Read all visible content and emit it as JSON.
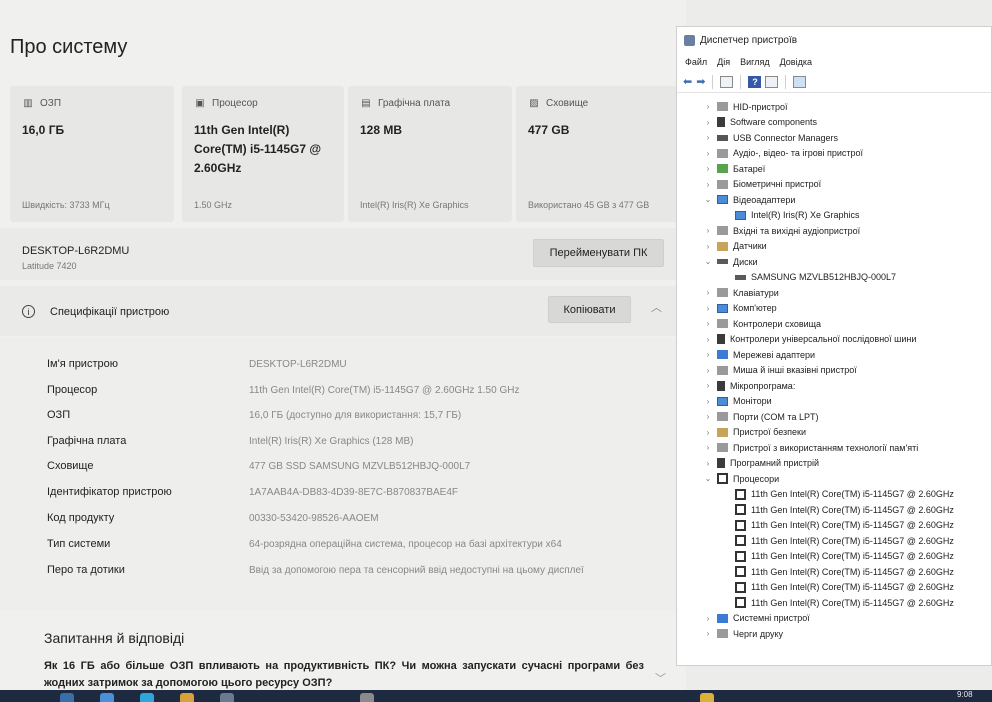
{
  "about": {
    "title": "Про систему",
    "cards": [
      {
        "icon": "ram-icon",
        "label": "ОЗП",
        "value": "16,0 ГБ",
        "sub": "Швидкість: 3733 МГц"
      },
      {
        "icon": "processor-icon",
        "label": "Процесор",
        "value": "11th Gen Intel(R) Core(TM) i5-1145G7 @ 2.60GHz",
        "sub": "1.50 GHz"
      },
      {
        "icon": "graphics-card-icon",
        "label": "Графічна плата",
        "value": "128 MB",
        "sub": "Intel(R) Iris(R) Xe Graphics"
      },
      {
        "icon": "storage-icon",
        "label": "Сховище",
        "value": "477 GB",
        "sub": "Використано 45 GB з 477 GB"
      }
    ],
    "device": {
      "name": "DESKTOP-L6R2DMU",
      "model": "Latitude 7420",
      "rename_label": "Перейменувати ПК"
    },
    "specs_section": {
      "title": "Специфікації пристрою",
      "copy_label": "Копіювати"
    },
    "specs": [
      {
        "label": "Ім'я пристрою",
        "value": "DESKTOP-L6R2DMU"
      },
      {
        "label": "Процесор",
        "value": "11th Gen Intel(R) Core(TM) i5-1145G7 @ 2.60GHz   1.50 GHz"
      },
      {
        "label": "ОЗП",
        "value": "16,0 ГБ (доступно для використання: 15,7 ГБ)"
      },
      {
        "label": "Графічна плата",
        "value": "Intel(R) Iris(R) Xe Graphics (128 MB)"
      },
      {
        "label": "Сховище",
        "value": "477 GB SSD SAMSUNG MZVLB512HBJQ-000L7"
      },
      {
        "label": "Ідентифікатор пристрою",
        "value": "1A7AAB4A-DB83-4D39-8E7C-B870837BAE4F"
      },
      {
        "label": "Код продукту",
        "value": "00330-53420-98526-AAOEM"
      },
      {
        "label": "Тип системи",
        "value": "64-розрядна операційна система, процесор на базі архітектури x64"
      },
      {
        "label": "Перо та дотики",
        "value": "Ввід за допомогою пера та сенсорний ввід недоступні на цьому дисплеї"
      }
    ],
    "faq": {
      "title": "Запитання й відповіді",
      "question": "Як 16 ГБ або більше ОЗП впливають на продуктивність ПК? Чи можна запускати сучасні програми без жодних затримок за допомогою цього ресурсу ОЗП?"
    }
  },
  "device_manager": {
    "title": "Диспетчер пристроїв",
    "menu": [
      "Файл",
      "Дія",
      "Вигляд",
      "Довідка"
    ],
    "tree": [
      {
        "label": "HID-пристрої",
        "level": 0,
        "expanded": false,
        "icon": "hid-icon"
      },
      {
        "label": "Software components",
        "level": 0,
        "expanded": false,
        "icon": "software-components-icon"
      },
      {
        "label": "USB Connector Managers",
        "level": 0,
        "expanded": false,
        "icon": "usb-connector-icon"
      },
      {
        "label": "Аудіо-, відео- та ігрові пристрої",
        "level": 0,
        "expanded": false,
        "icon": "audio-icon"
      },
      {
        "label": "Батареї",
        "level": 0,
        "expanded": false,
        "icon": "battery-icon"
      },
      {
        "label": "Біометричні пристрої",
        "level": 0,
        "expanded": false,
        "icon": "biometric-icon"
      },
      {
        "label": "Відеоадаптери",
        "level": 0,
        "expanded": true,
        "icon": "display-adapter-icon"
      },
      {
        "label": "Intel(R) Iris(R) Xe Graphics",
        "level": 1,
        "icon": "display-adapter-icon"
      },
      {
        "label": "Вхідні та вихідні аудіопристрої",
        "level": 0,
        "expanded": false,
        "icon": "audio-io-icon"
      },
      {
        "label": "Датчики",
        "level": 0,
        "expanded": false,
        "icon": "sensor-icon"
      },
      {
        "label": "Диски",
        "level": 0,
        "expanded": true,
        "icon": "disk-icon"
      },
      {
        "label": "SAMSUNG MZVLB512HBJQ-000L7",
        "level": 1,
        "icon": "disk-icon"
      },
      {
        "label": "Клавіатури",
        "level": 0,
        "expanded": false,
        "icon": "keyboard-icon"
      },
      {
        "label": "Комп'ютер",
        "level": 0,
        "expanded": false,
        "icon": "computer-icon"
      },
      {
        "label": "Контролери сховища",
        "level": 0,
        "expanded": false,
        "icon": "storage-controller-icon"
      },
      {
        "label": "Контролери універсальної послідовної шини",
        "level": 0,
        "expanded": false,
        "icon": "usb-icon"
      },
      {
        "label": "Мережеві адаптери",
        "level": 0,
        "expanded": false,
        "icon": "network-icon"
      },
      {
        "label": "Миша й інші вказівні пристрої",
        "level": 0,
        "expanded": false,
        "icon": "mouse-icon"
      },
      {
        "label": "Мікропрограма:",
        "level": 0,
        "expanded": false,
        "icon": "firmware-icon"
      },
      {
        "label": "Монітори",
        "level": 0,
        "expanded": false,
        "icon": "monitor-icon"
      },
      {
        "label": "Порти (COM та LPT)",
        "level": 0,
        "expanded": false,
        "icon": "port-icon"
      },
      {
        "label": "Пристрої безпеки",
        "level": 0,
        "expanded": false,
        "icon": "security-device-icon"
      },
      {
        "label": "Пристрої з використанням технології пам'яті",
        "level": 0,
        "expanded": false,
        "icon": "memory-tech-icon"
      },
      {
        "label": "Програмний пристрій",
        "level": 0,
        "expanded": false,
        "icon": "software-device-icon"
      },
      {
        "label": "Процесори",
        "level": 0,
        "expanded": true,
        "icon": "processor-icon"
      },
      {
        "label": "11th Gen Intel(R) Core(TM) i5-1145G7 @ 2.60GHz",
        "level": 1,
        "icon": "processor-icon"
      },
      {
        "label": "11th Gen Intel(R) Core(TM) i5-1145G7 @ 2.60GHz",
        "level": 1,
        "icon": "processor-icon"
      },
      {
        "label": "11th Gen Intel(R) Core(TM) i5-1145G7 @ 2.60GHz",
        "level": 1,
        "icon": "processor-icon"
      },
      {
        "label": "11th Gen Intel(R) Core(TM) i5-1145G7 @ 2.60GHz",
        "level": 1,
        "icon": "processor-icon"
      },
      {
        "label": "11th Gen Intel(R) Core(TM) i5-1145G7 @ 2.60GHz",
        "level": 1,
        "icon": "processor-icon"
      },
      {
        "label": "11th Gen Intel(R) Core(TM) i5-1145G7 @ 2.60GHz",
        "level": 1,
        "icon": "processor-icon"
      },
      {
        "label": "11th Gen Intel(R) Core(TM) i5-1145G7 @ 2.60GHz",
        "level": 1,
        "icon": "processor-icon"
      },
      {
        "label": "11th Gen Intel(R) Core(TM) i5-1145G7 @ 2.60GHz",
        "level": 1,
        "icon": "processor-icon"
      },
      {
        "label": "Системні пристрої",
        "level": 0,
        "expanded": false,
        "icon": "system-devices-icon"
      },
      {
        "label": "Черги друку",
        "level": 0,
        "expanded": false,
        "icon": "print-queue-icon"
      }
    ]
  },
  "taskbar": {
    "time": "9:08"
  }
}
